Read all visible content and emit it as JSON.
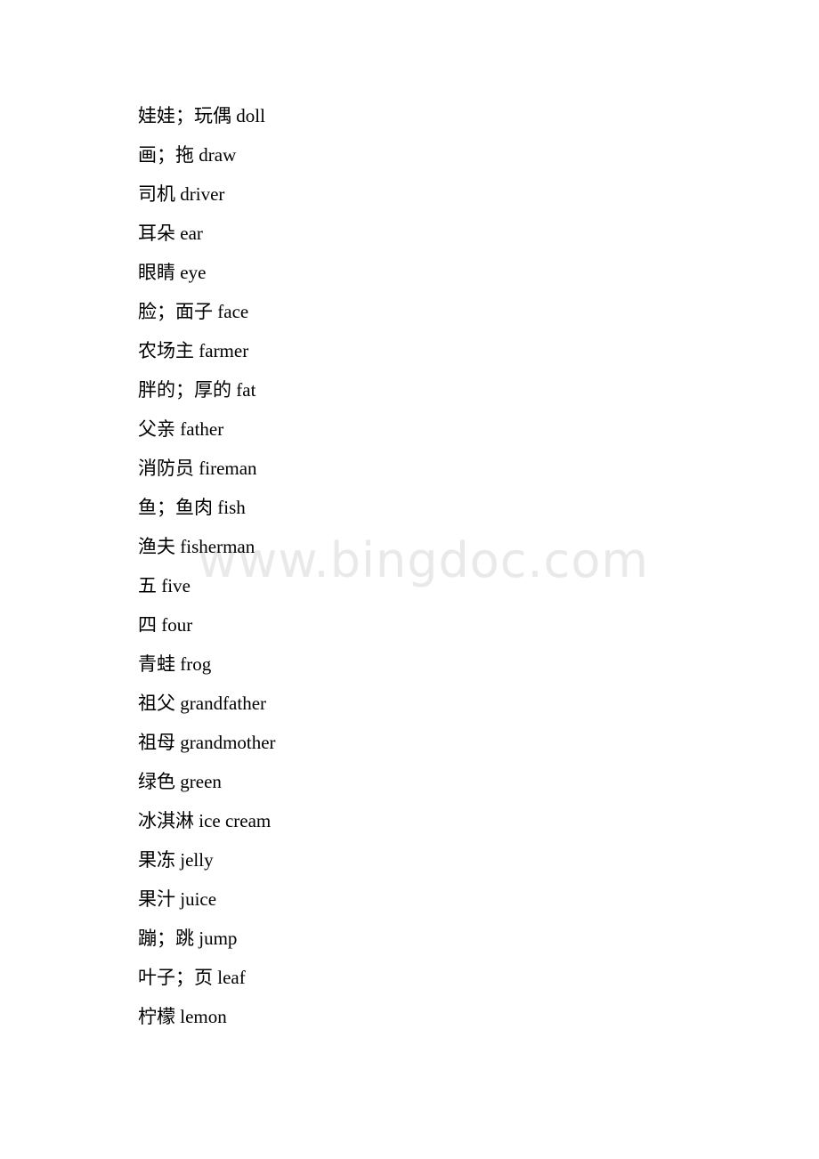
{
  "document": {
    "type": "vocabulary-list",
    "language_pair": "Chinese-English",
    "watermark": "www.bingdoc.com",
    "watermark_color": "#e9e9e9",
    "text_color": "#000000",
    "page_background": "#ffffff"
  },
  "entries": [
    {
      "text": "娃娃；玩偶 doll",
      "chinese": "娃娃；玩偶",
      "english": "doll"
    },
    {
      "text": "画；拖 draw",
      "chinese": "画；拖",
      "english": "draw"
    },
    {
      "text": "司机 driver",
      "chinese": "司机",
      "english": "driver"
    },
    {
      "text": "耳朵 ear",
      "chinese": "耳朵",
      "english": "ear"
    },
    {
      "text": "眼睛 eye",
      "chinese": "眼睛",
      "english": "eye"
    },
    {
      "text": "脸；面子 face",
      "chinese": "脸；面子",
      "english": "face"
    },
    {
      "text": "农场主 farmer",
      "chinese": "农场主",
      "english": "farmer"
    },
    {
      "text": "胖的；厚的 fat",
      "chinese": "胖的；厚的",
      "english": "fat"
    },
    {
      "text": "父亲 father",
      "chinese": "父亲",
      "english": "father"
    },
    {
      "text": "消防员 fireman",
      "chinese": "消防员",
      "english": "fireman"
    },
    {
      "text": "鱼；鱼肉 fish",
      "chinese": "鱼；鱼肉",
      "english": "fish"
    },
    {
      "text": "渔夫 fisherman",
      "chinese": "渔夫",
      "english": "fisherman"
    },
    {
      "text": "五 five",
      "chinese": "五",
      "english": "five"
    },
    {
      "text": "四 four",
      "chinese": "四",
      "english": "four"
    },
    {
      "text": "青蛙 frog",
      "chinese": "青蛙",
      "english": "frog"
    },
    {
      "text": "祖父 grandfather",
      "chinese": "祖父",
      "english": "grandfather"
    },
    {
      "text": "祖母 grandmother",
      "chinese": "祖母",
      "english": "grandmother"
    },
    {
      "text": "绿色 green",
      "chinese": "绿色",
      "english": "green"
    },
    {
      "text": "冰淇淋 ice cream",
      "chinese": "冰淇淋",
      "english": "ice cream"
    },
    {
      "text": "果冻 jelly",
      "chinese": "果冻",
      "english": "jelly"
    },
    {
      "text": "果汁 juice",
      "chinese": "果汁",
      "english": "juice"
    },
    {
      "text": "蹦；跳 jump",
      "chinese": "蹦；跳",
      "english": "jump"
    },
    {
      "text": "叶子；页 leaf",
      "chinese": "叶子；页",
      "english": "leaf"
    },
    {
      "text": "柠檬 lemon",
      "chinese": "柠檬",
      "english": "lemon"
    }
  ]
}
